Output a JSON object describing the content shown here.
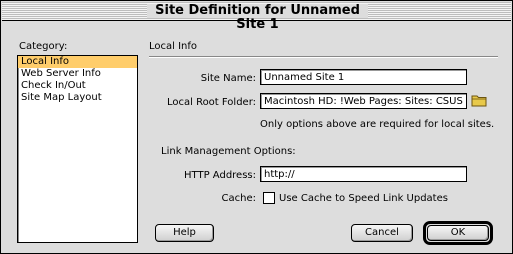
{
  "window": {
    "title": "Site Definition for Unnamed Site 1"
  },
  "category": {
    "label": "Category:",
    "items": [
      "Local Info",
      "Web Server Info",
      "Check In/Out",
      "Site Map Layout"
    ],
    "selected": "Local Info"
  },
  "local_info": {
    "section_title": "Local Info",
    "site_name_label": "Site Name:",
    "site_name_value": "Unnamed Site 1",
    "root_folder_label": "Local Root Folder:",
    "root_folder_value": "Macintosh HD:  !Web Pages: Sites: CSUS Web",
    "note": "Only options above are required for local sites.",
    "link_mgmt_heading": "Link Management Options:",
    "http_label": "HTTP Address:",
    "http_value": "http://",
    "cache_label": "Cache:",
    "cache_checkbox_label": "Use Cache to Speed Link Updates",
    "cache_checked": false
  },
  "buttons": {
    "help": "Help",
    "cancel": "Cancel",
    "ok": "OK"
  },
  "colors": {
    "selection": "#ffcd6b",
    "folder_icon": "#e8c94a"
  },
  "icons": {
    "folder": "folder-icon"
  }
}
